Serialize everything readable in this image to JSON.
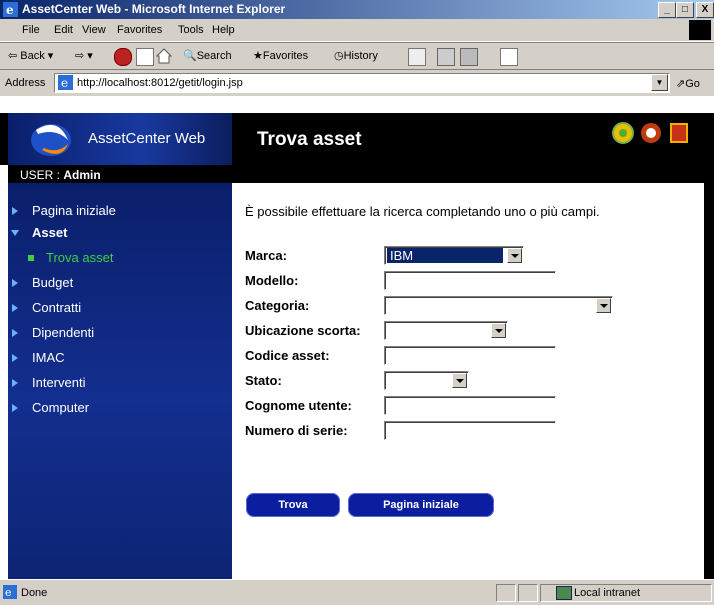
{
  "window": {
    "title": "AssetCenter Web - Microsoft Internet Explorer",
    "minimize": "_",
    "maximize": "□",
    "close": "X"
  },
  "menu": [
    "File",
    "Edit",
    "View",
    "Favorites",
    "Tools",
    "Help"
  ],
  "toolbar": {
    "back": "Back",
    "search": "Search",
    "favorites": "Favorites",
    "history": "History"
  },
  "address": {
    "label": "Address",
    "url": "http://localhost:8012/getit/login.jsp",
    "go": "Go"
  },
  "header": {
    "brand": "AssetCenter Web",
    "page_title": "Trova asset",
    "user_label": "USER : ",
    "user_name": "Admin"
  },
  "sidebar": {
    "items": [
      {
        "label": "Pagina iniziale"
      },
      {
        "label": "Asset",
        "expanded": true
      },
      {
        "label": "Trova asset",
        "sub": true,
        "active": true
      },
      {
        "label": "Budget"
      },
      {
        "label": "Contratti"
      },
      {
        "label": "Dipendenti"
      },
      {
        "label": "IMAC"
      },
      {
        "label": "Interventi"
      },
      {
        "label": "Computer"
      }
    ]
  },
  "form": {
    "intro": "È possibile effettuare la ricerca completando uno o più campi.",
    "fields": {
      "marca": {
        "label": "Marca:",
        "value": "IBM"
      },
      "modello": {
        "label": "Modello:",
        "value": ""
      },
      "categoria": {
        "label": "Categoria:",
        "value": ""
      },
      "ubicazione": {
        "label": "Ubicazione scorta:",
        "value": ""
      },
      "codice": {
        "label": "Codice asset:",
        "value": ""
      },
      "stato": {
        "label": "Stato:",
        "value": ""
      },
      "cognome": {
        "label": "Cognome utente:",
        "value": ""
      },
      "seriale": {
        "label": "Numero di serie:",
        "value": ""
      }
    },
    "buttons": {
      "search": "Trova",
      "home": "Pagina iniziale"
    }
  },
  "status": {
    "left": "Done",
    "zone": "Local intranet"
  },
  "colors": {
    "titlebar": "#0a246a",
    "sidebar": "#132f8f",
    "active_nav": "#3fcf3f",
    "button": "#0c1ea0"
  }
}
